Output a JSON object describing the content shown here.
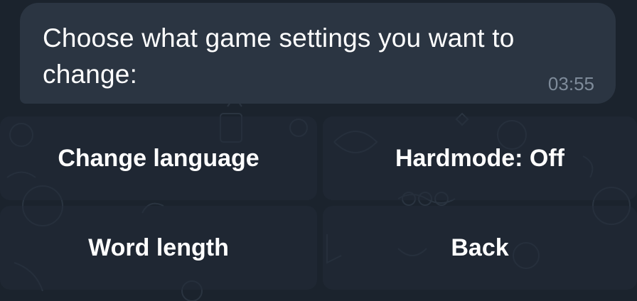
{
  "message": {
    "text": "Choose what game settings you want to change:",
    "time": "03:55"
  },
  "keyboard": {
    "buttons": [
      {
        "label": "Change language"
      },
      {
        "label": "Hardmode: Off"
      },
      {
        "label": "Word length"
      },
      {
        "label": "Back"
      }
    ]
  },
  "colors": {
    "background": "#1b232d",
    "bubble": "#2b3542",
    "text": "#ffffff",
    "timestamp": "#7e8b9a"
  }
}
